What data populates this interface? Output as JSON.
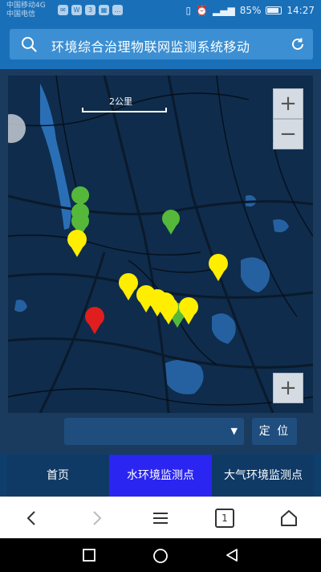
{
  "status_bar": {
    "carrier_1": "中国移动4G",
    "carrier_2": "中国电信",
    "battery": "85%",
    "time": "14:27"
  },
  "header": {
    "title": "环境综合治理物联网监测系统移动"
  },
  "map": {
    "scale_label": "2公里",
    "zoom_in": "+",
    "zoom_out": "−",
    "zoom_in_2": "+",
    "markers": [
      {
        "status": "normal",
        "color": "#55b83a"
      },
      {
        "status": "normal",
        "color": "#55b83a"
      },
      {
        "status": "normal",
        "color": "#55b83a"
      },
      {
        "status": "normal",
        "color": "#55b83a"
      },
      {
        "status": "warning",
        "color": "#ffee00"
      },
      {
        "status": "warning",
        "color": "#ffee00"
      },
      {
        "status": "warning",
        "color": "#ffee00"
      },
      {
        "status": "warning",
        "color": "#ffee00"
      },
      {
        "status": "warning",
        "color": "#ffee00"
      },
      {
        "status": "warning",
        "color": "#ffee00"
      },
      {
        "status": "warning",
        "color": "#ffee00"
      },
      {
        "status": "warning",
        "color": "#ffee00"
      },
      {
        "status": "alarm",
        "color": "#e01e1e"
      }
    ]
  },
  "controls": {
    "select_value": "",
    "locate_label": "定 位"
  },
  "tabs": [
    {
      "label": "首页",
      "active": false
    },
    {
      "label": "水环境监测点",
      "active": true
    },
    {
      "label": "大气环境监测点",
      "active": false
    }
  ],
  "browser": {
    "tab_count": "1"
  },
  "colors": {
    "header": "#1a70b8",
    "search": "#3c8fd2",
    "map_bg": "#0f2c4c",
    "active_tab": "#2a25f0"
  }
}
